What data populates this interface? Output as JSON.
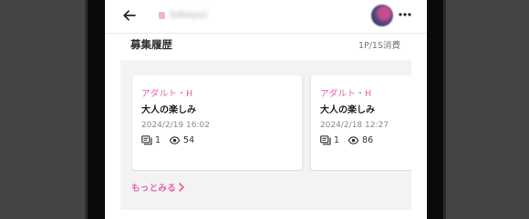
{
  "header": {
    "username": "Safeayo1",
    "back_icon": "arrow-left-icon",
    "more_icon": "more-horizontal-icon"
  },
  "section": {
    "title": "募集履歴",
    "meta": "1P/1S消費"
  },
  "cards": [
    {
      "category": "アダルト・H",
      "title": "大人の楽しみ",
      "date": "2024/2/19 16:02",
      "replies": "1",
      "views": "54"
    },
    {
      "category": "アダルト・H",
      "title": "大人の楽しみ",
      "date": "2024/2/18 12:27",
      "replies": "1",
      "views": "86"
    }
  ],
  "more_link": {
    "label": "もっとみる"
  },
  "colors": {
    "accent_pink": "#e862a8",
    "panel_bg": "#f3f3f3",
    "page_bg": "#454545"
  }
}
